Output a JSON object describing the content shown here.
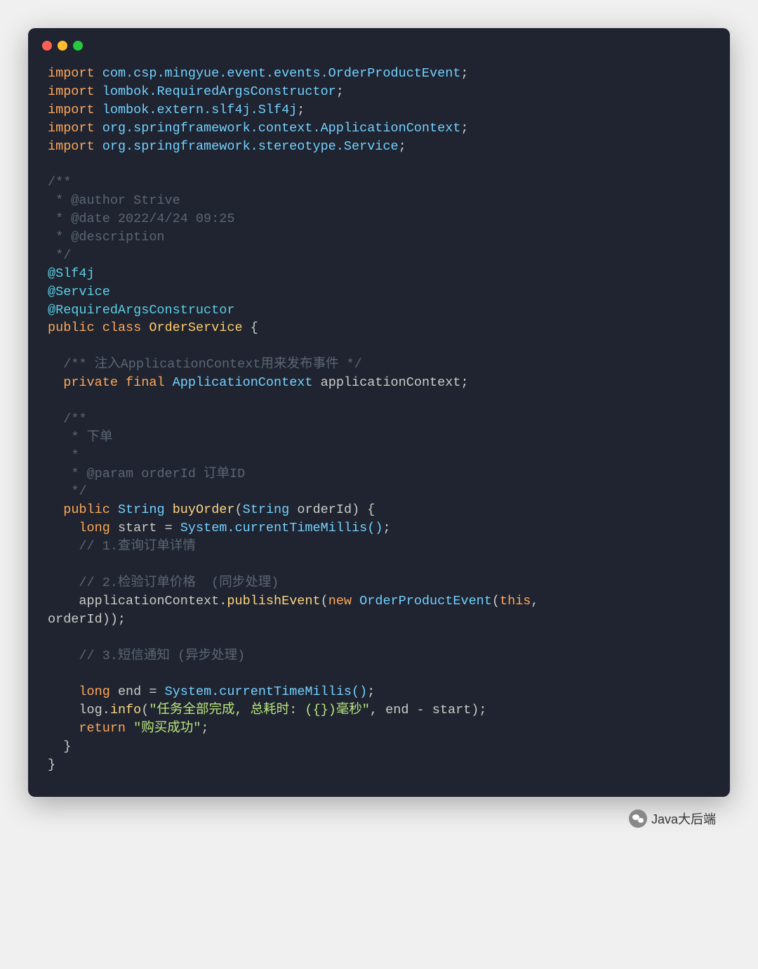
{
  "imports": [
    {
      "kw": "import",
      "path": "com.csp.mingyue.event.events.OrderProductEvent"
    },
    {
      "kw": "import",
      "path": "lombok.RequiredArgsConstructor"
    },
    {
      "kw": "import",
      "path": "lombok.extern.slf4j.Slf4j"
    },
    {
      "kw": "import",
      "path": "org.springframework.context.ApplicationContext"
    },
    {
      "kw": "import",
      "path": "org.springframework.stereotype.Service"
    }
  ],
  "classdoc": {
    "open": "/**",
    "line1": " * @author Strive",
    "line2": " * @date 2022/4/24 09:25",
    "line3": " * @description",
    "close": " */"
  },
  "annotations": {
    "a1": "@Slf4j",
    "a2": "@Service",
    "a3": "@RequiredArgsConstructor"
  },
  "classDecl": {
    "kwPublic": "public",
    "kwClass": "class",
    "name": "OrderService",
    "brace": "{"
  },
  "fieldComment": "/** 注入ApplicationContext用来发布事件 */",
  "field": {
    "kwPrivate": "private",
    "kwFinal": "final",
    "type": "ApplicationContext",
    "name": "applicationContext"
  },
  "methodDoc": {
    "open": "/**",
    "line1": " * 下单",
    "line2": " *",
    "line3": " * @param orderId 订单ID",
    "close": " */"
  },
  "method": {
    "kwPublic": "public",
    "retType": "String",
    "name": "buyOrder",
    "paramType": "String",
    "paramName": "orderId",
    "brace": "{"
  },
  "body": {
    "kwLong1": "long",
    "start": "start",
    "systemCall1": "System.currentTimeMillis()",
    "c1": "// 1.查询订单详情",
    "c2": "// 2.检验订单价格  (同步处理)",
    "publishLine": {
      "obj": "applicationContext",
      "method": "publishEvent",
      "kwNew": "new",
      "eventCls": "OrderProductEvent",
      "kwThis": "this",
      "arg2": "orderId"
    },
    "c3": "// 3.短信通知 (异步处理)",
    "kwLong2": "long",
    "end": "end",
    "systemCall2": "System.currentTimeMillis()",
    "logObj": "log",
    "logMethod": "info",
    "logStr": "\"任务全部完成, 总耗时: ({})毫秒\"",
    "logArg1": "end",
    "logArg2": "start",
    "kwReturn": "return",
    "retStr": "\"购买成功\""
  },
  "footer": {
    "text": "Java大后端"
  }
}
